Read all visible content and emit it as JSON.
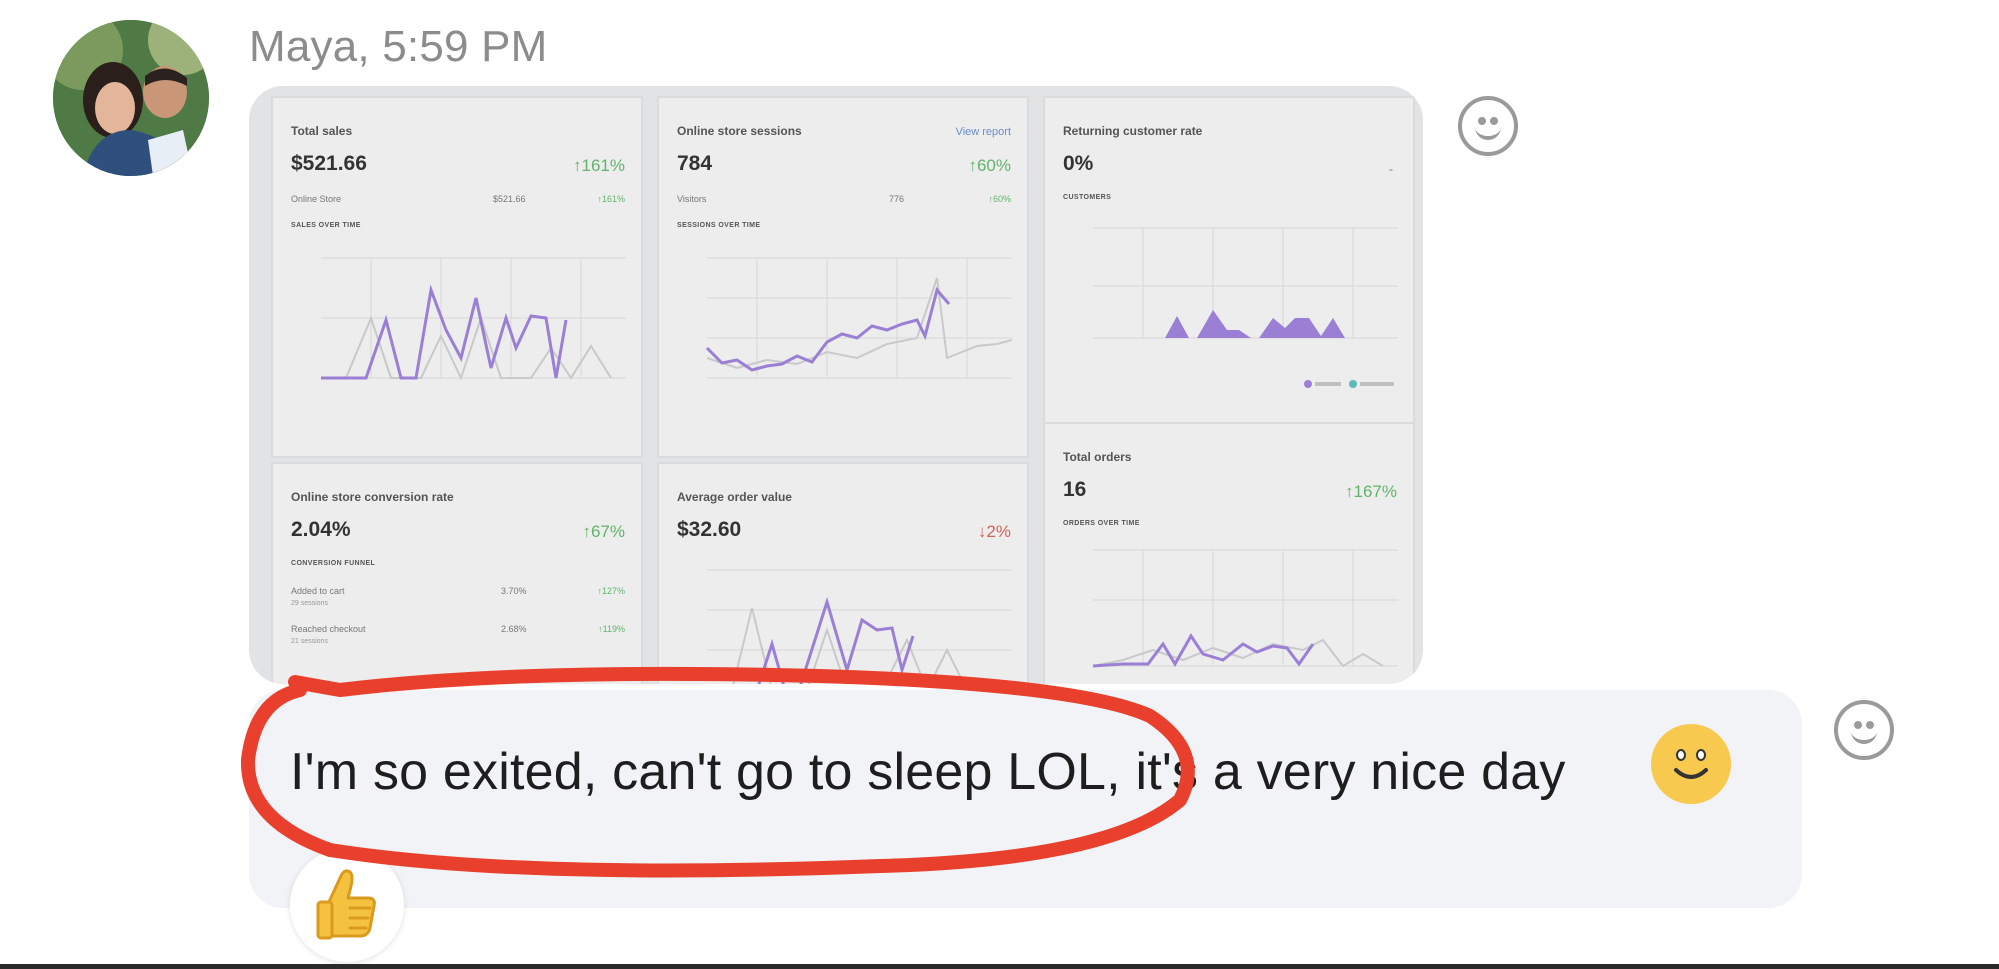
{
  "message": {
    "sender_line": "Maya, 5:59 PM",
    "text": "I'm so exited, can't go to sleep LOL, it's a very nice day",
    "emoji": "slightly-smiling-face",
    "reaction": "thumbs-up"
  },
  "dashboard": {
    "total_sales": {
      "title": "Total sales",
      "value": "$521.66",
      "change": "↑161%",
      "row_label": "Online Store",
      "row_value": "$521.66",
      "row_change": "↑161%",
      "caption": "SALES OVER TIME"
    },
    "online_sessions": {
      "title": "Online store sessions",
      "link": "View report",
      "value": "784",
      "change": "↑60%",
      "row_label": "Visitors",
      "row_value": "776",
      "row_change": "↑60%",
      "caption": "SESSIONS OVER TIME"
    },
    "returning_rate": {
      "title": "Returning customer rate",
      "value": "0%",
      "dash": "-",
      "caption": "CUSTOMERS"
    },
    "conversion": {
      "title": "Online store conversion rate",
      "value": "2.04%",
      "change": "↑67%",
      "caption": "CONVERSION FUNNEL",
      "rows": [
        {
          "label": "Added to cart",
          "sub": "29 sessions",
          "value": "3.70%",
          "change": "↑127%"
        },
        {
          "label": "Reached checkout",
          "sub": "21 sessions",
          "value": "2.68%",
          "change": "↑119%"
        }
      ]
    },
    "avg_order": {
      "title": "Average order value",
      "value": "$32.60",
      "change": "↓2%"
    },
    "total_orders": {
      "title": "Total orders",
      "value": "16",
      "change": "↑167%",
      "caption": "ORDERS OVER TIME"
    }
  },
  "colors": {
    "purple": "#9b7fd4",
    "grey_line": "#c9c9c9",
    "green": "#62b46a",
    "red": "#d0645a",
    "annotation_red": "#e8402d",
    "bubble": "#f1f3f6"
  }
}
